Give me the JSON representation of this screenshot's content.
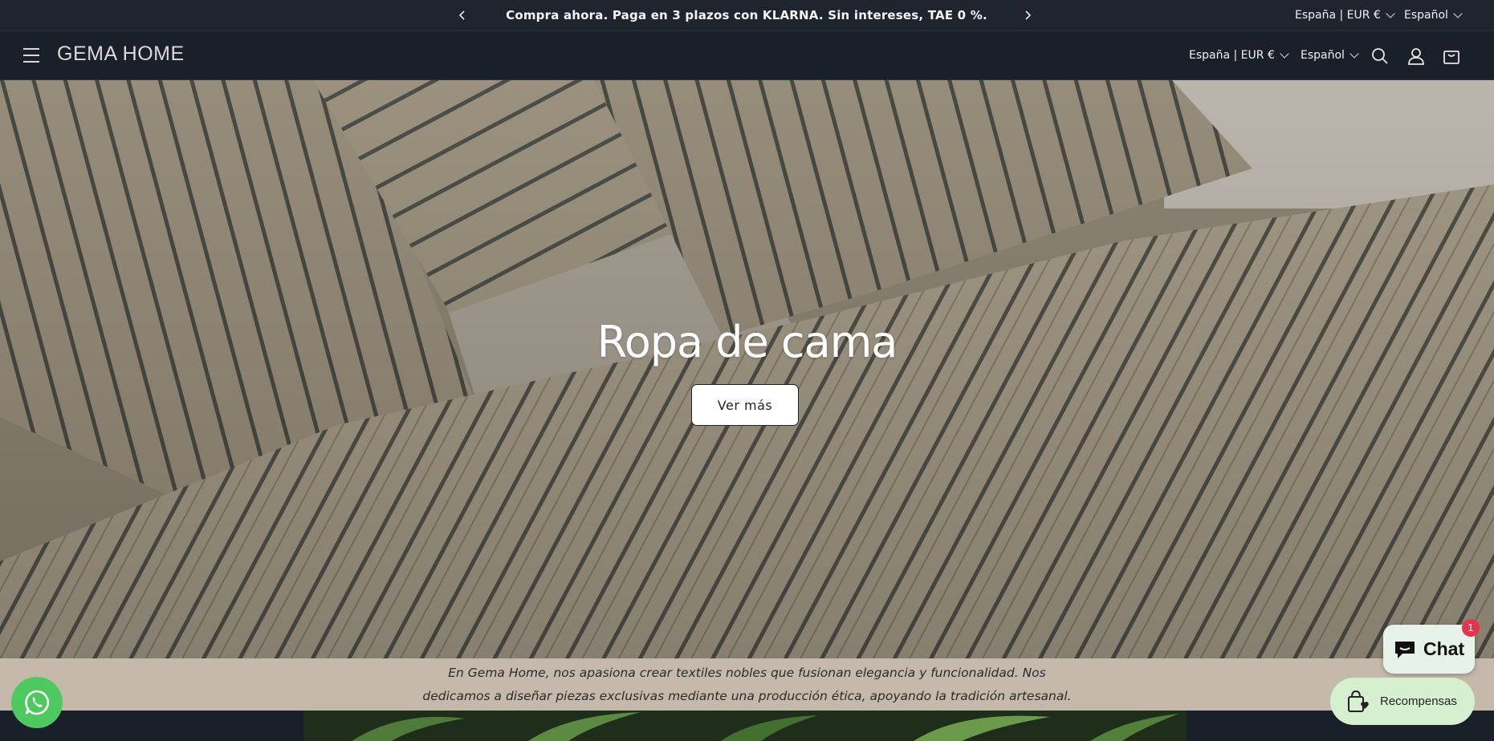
{
  "announcement": {
    "message": "Compra ahora. Paga en 3 plazos con KLARNA. Sin intereses, TAE 0 %.",
    "prev_icon": "chevron-left-icon",
    "next_icon": "chevron-right-icon",
    "country": "España | EUR €",
    "language": "Español"
  },
  "header": {
    "menu_icon": "hamburger-icon",
    "logo": "GEMA HOME",
    "country": "España | EUR €",
    "language": "Español",
    "search_icon": "search-icon",
    "account_icon": "account-icon",
    "cart_icon": "cart-icon"
  },
  "hero": {
    "title": "Ropa de cama",
    "button_label": "Ver más"
  },
  "mission": {
    "line1": "En Gema Home, nos apasiona crear textiles nobles que fusionan elegancia y funcionalidad. Nos",
    "line2": "dedicamos a diseñar piezas exclusivas mediante una producción ética, apoyando la tradición artesanal."
  },
  "widgets": {
    "whatsapp_icon": "whatsapp-icon",
    "chat_label": "Chat",
    "chat_badge": "1",
    "rewards_label": "Recompensas"
  },
  "colors": {
    "header_bg": "#1a2029",
    "mission_bg": "#c5b9ac",
    "whatsapp": "#4dc95f",
    "rewards_bg": "#d6f0cf",
    "badge": "#e3354b"
  }
}
